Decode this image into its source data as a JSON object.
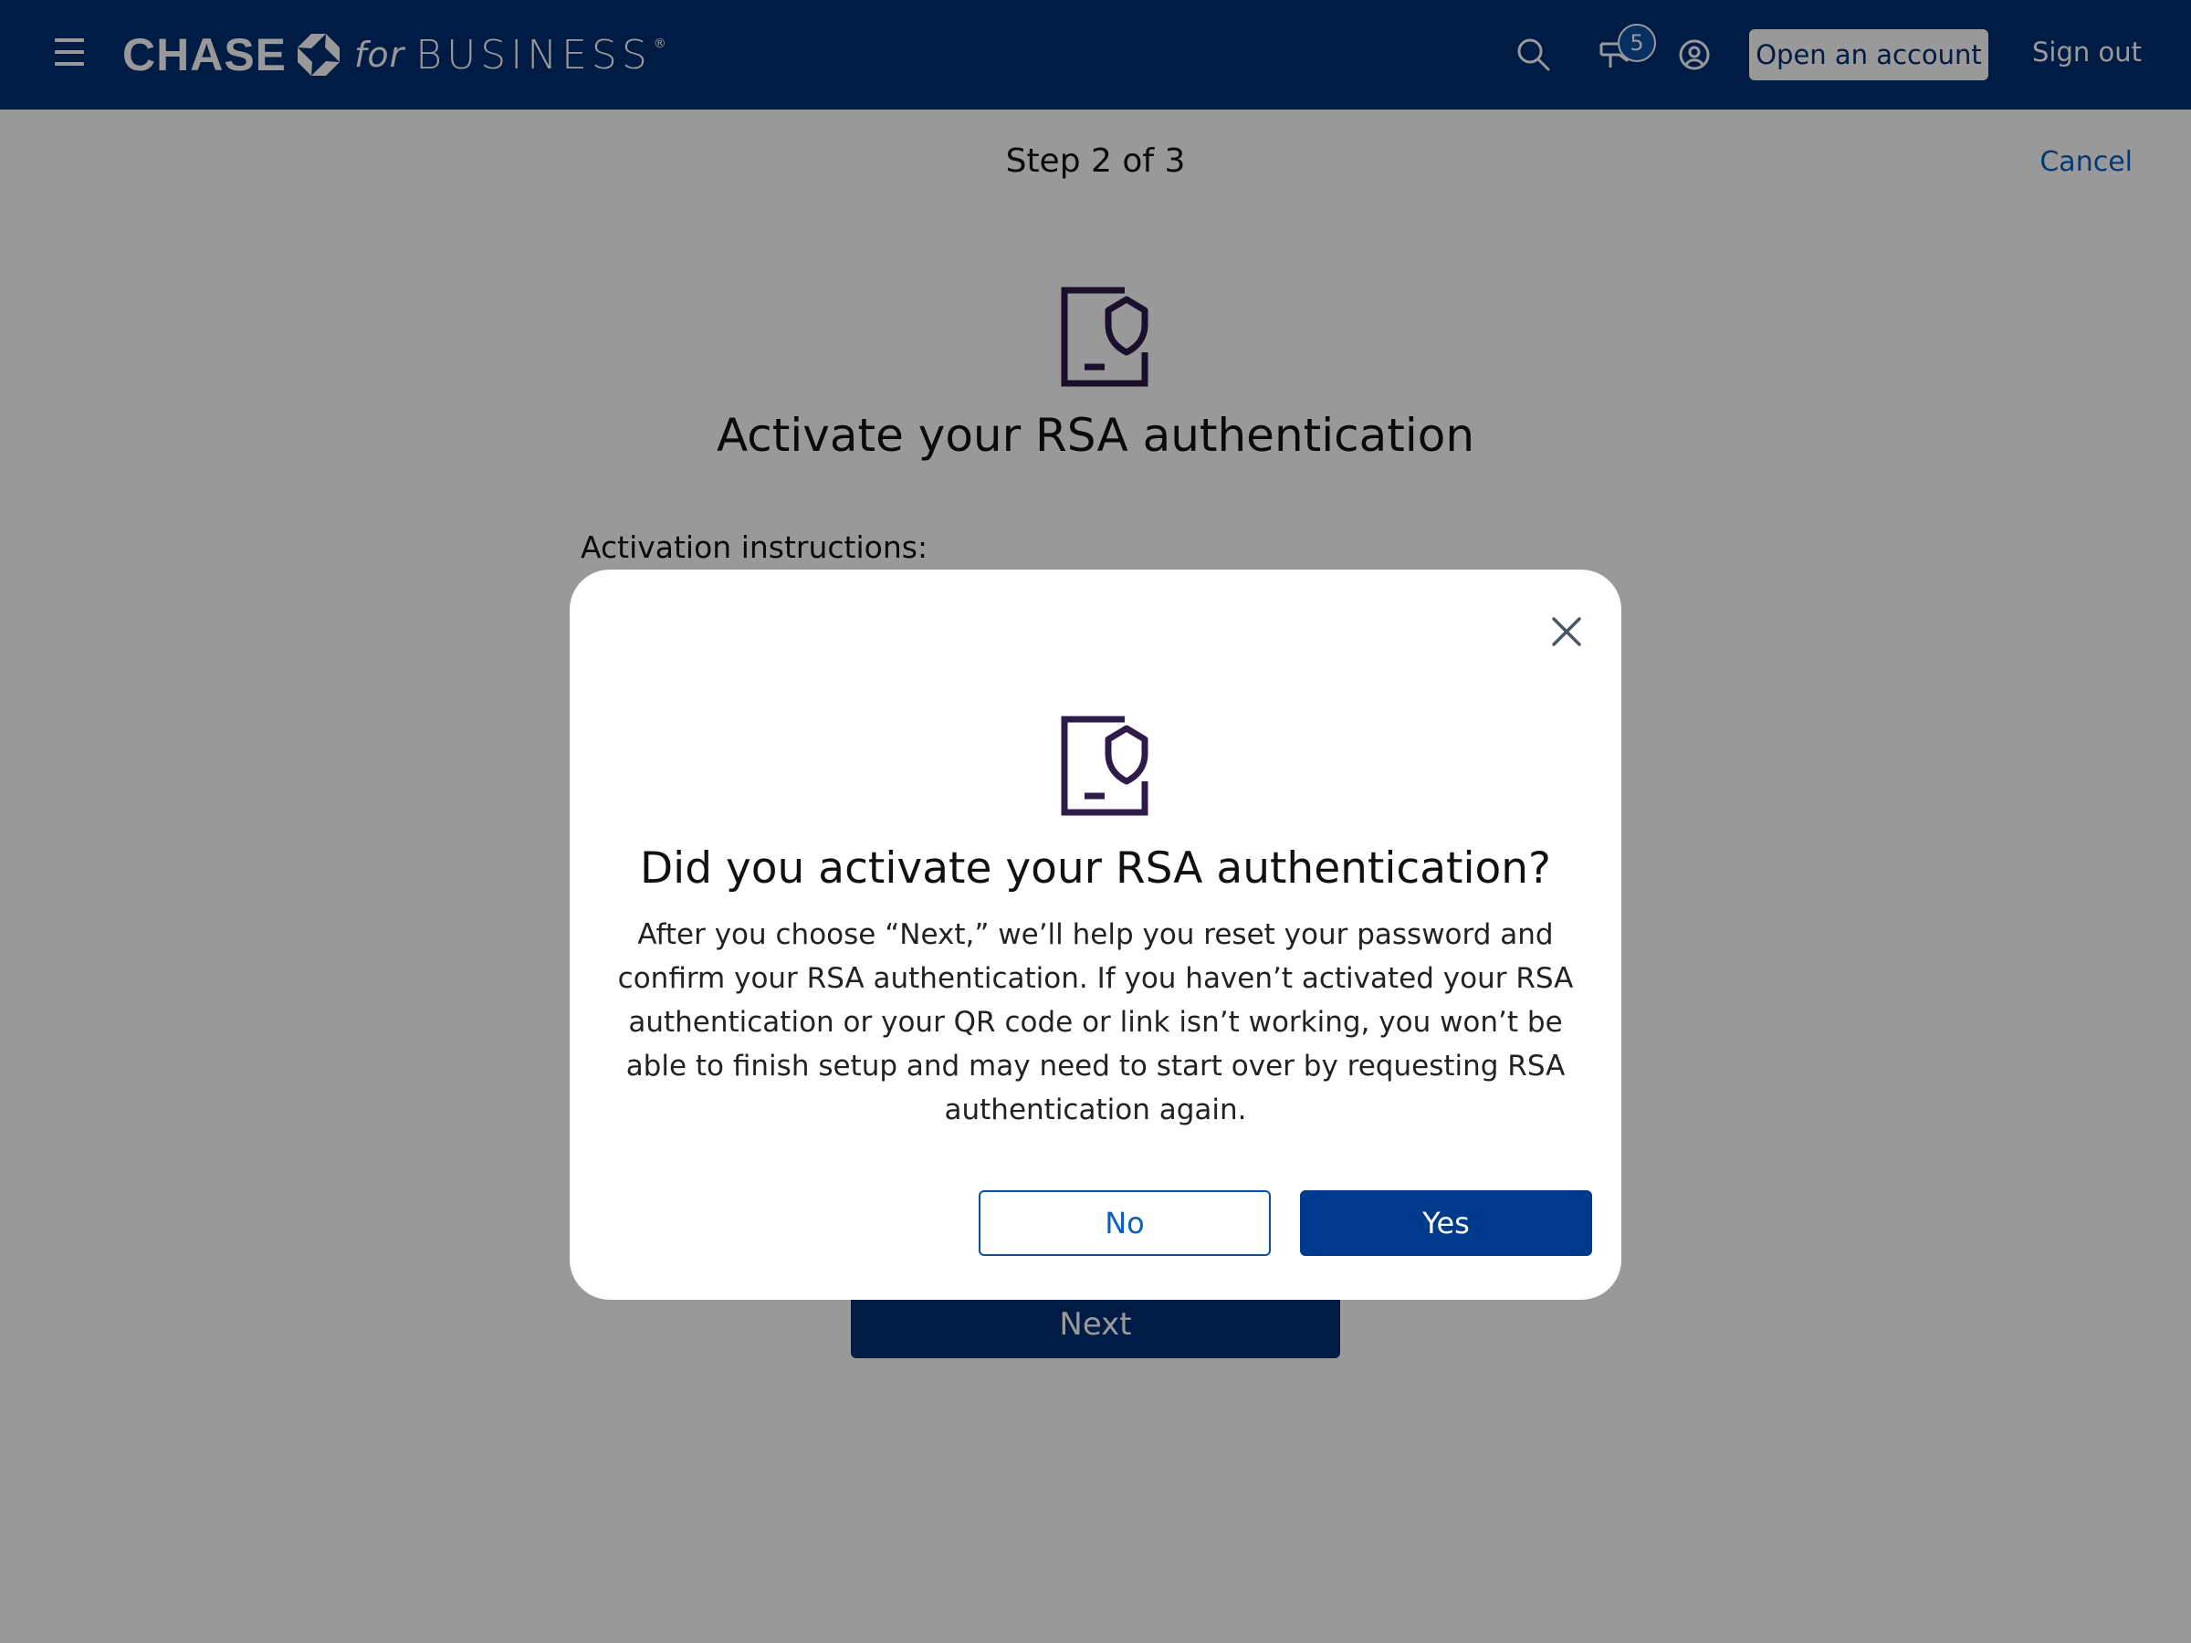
{
  "header": {
    "logo": {
      "brand": "CHASE",
      "for_text": "for",
      "business_text": "BUSINESS",
      "registered_mark": "®"
    },
    "notification_count": "5",
    "open_account_label": "Open an account",
    "sign_out_label": "Sign out",
    "icons": [
      "hamburger-menu-icon",
      "chase-octagon-icon",
      "search-icon",
      "notification-icon",
      "profile-icon"
    ]
  },
  "page": {
    "step_label": "Step 2 of 3",
    "cancel_label": "Cancel",
    "title": "Activate your RSA authentication",
    "instructions_label": "Activation instructions:",
    "next_label": "Next",
    "icon": "phone-shield-icon"
  },
  "modal": {
    "title": "Did you activate your RSA authentication?",
    "body": "After you choose “Next,” we’ll help you reset your password and confirm your RSA authentication. If you haven’t activated your RSA authentication or your QR code or link isn’t working, you won’t be able to finish setup and may need to start over by requesting RSA authentication again.",
    "no_label": "No",
    "yes_label": "Yes",
    "icons": [
      "close-icon",
      "phone-shield-icon"
    ]
  },
  "colors": {
    "header_bg": "#002d72",
    "primary_button": "#002d72",
    "link": "#0b5fc2",
    "icon_purple": "#2d1c4a",
    "overlay": "rgba(0,0,0,0.4)"
  }
}
